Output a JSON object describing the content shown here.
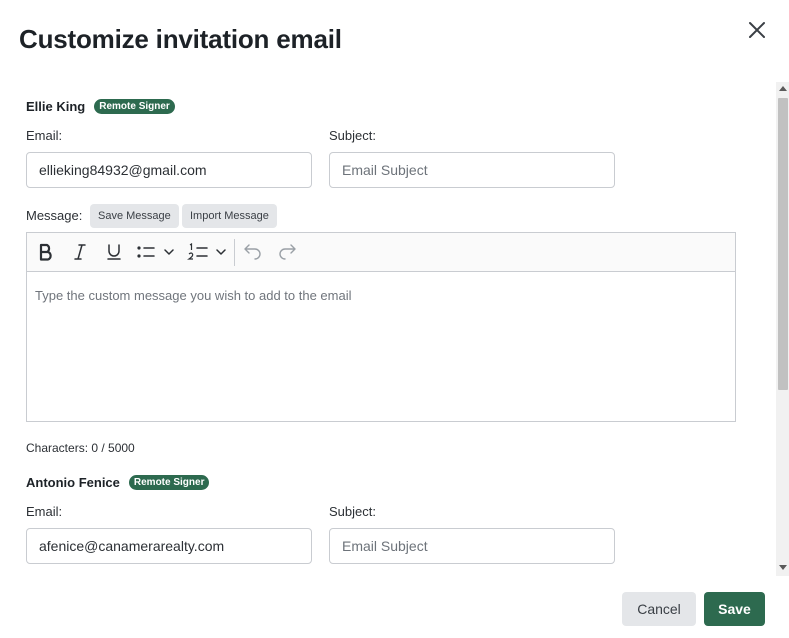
{
  "dialog": {
    "title": "Customize invitation email"
  },
  "signers": [
    {
      "name": "Ellie King",
      "badge": "Remote Signer",
      "email_label": "Email:",
      "email_value": "ellieking84932@gmail.com",
      "subject_label": "Subject:",
      "subject_placeholder": "Email Subject",
      "message_label": "Message:",
      "save_message_label": "Save Message",
      "import_message_label": "Import Message",
      "message_placeholder": "Type the custom message you wish to add to the email",
      "char_count": "Characters: 0 / 5000"
    },
    {
      "name": "Antonio Fenice",
      "badge": "Remote Signer",
      "email_label": "Email:",
      "email_value": "afenice@canamerarealty.com",
      "subject_label": "Subject:",
      "subject_placeholder": "Email Subject"
    }
  ],
  "footer": {
    "cancel_label": "Cancel",
    "save_label": "Save"
  },
  "colors": {
    "brand": "#2d6a4f"
  },
  "icons": {
    "close": "close-icon",
    "bold": "bold-icon",
    "italic": "italic-icon",
    "underline": "underline-icon",
    "bullet_list": "bullet-list-icon",
    "numbered_list": "numbered-list-icon",
    "undo": "undo-icon",
    "redo": "redo-icon"
  }
}
